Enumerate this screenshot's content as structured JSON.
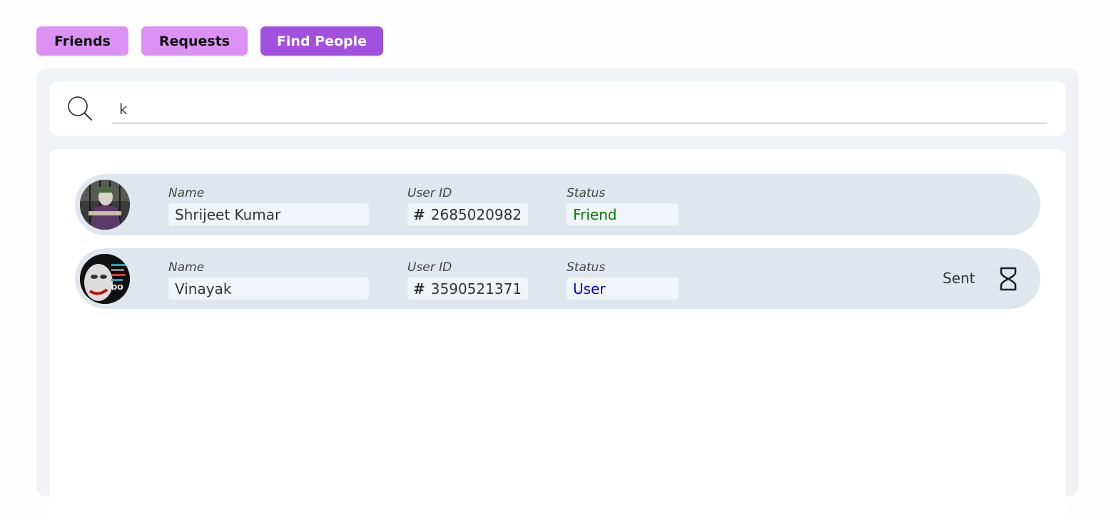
{
  "tabs": [
    {
      "label": "Friends"
    },
    {
      "label": "Requests"
    },
    {
      "label": "Find People"
    }
  ],
  "search": {
    "value": "k"
  },
  "field_labels": {
    "name": "Name",
    "user_id": "User ID",
    "status": "Status"
  },
  "results": [
    {
      "name": "Shrijeet Kumar",
      "user_id": "2685020982",
      "status": "Friend",
      "status_color": "#008000"
    },
    {
      "name": "Vinayak",
      "user_id": "3590521371",
      "status": "User",
      "status_color": "#0000cc",
      "action_label": "Sent"
    }
  ],
  "colors": {
    "tab_inactive": "#dc92f4",
    "tab_active": "#a250de",
    "panel_bg": "#eff3f8",
    "row_bg": "#e0e6ee"
  }
}
